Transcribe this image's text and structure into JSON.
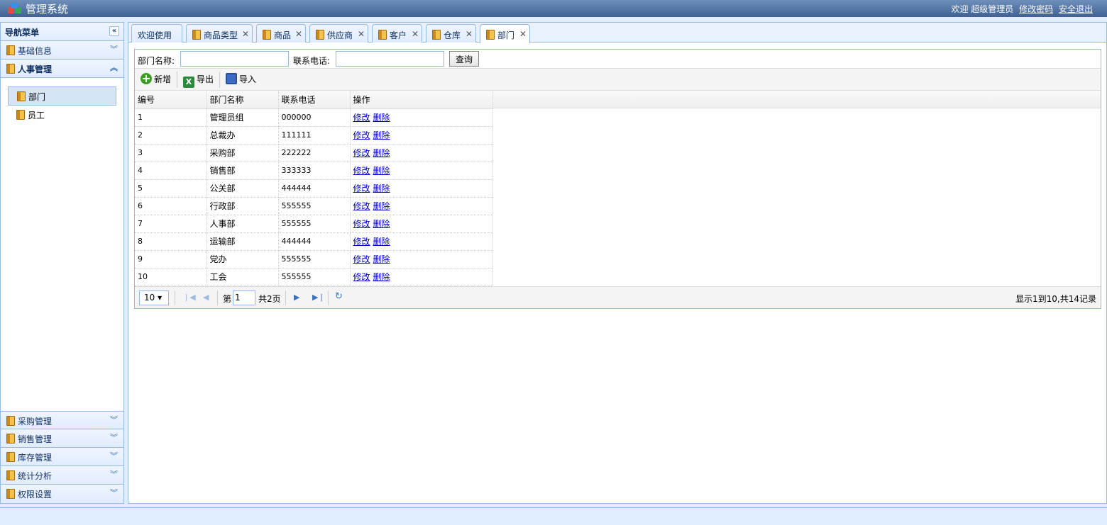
{
  "header": {
    "title": "管理系统",
    "welcome": "欢迎",
    "username": "超级管理员",
    "change_password": "修改密码",
    "logout": "安全退出"
  },
  "sidebar": {
    "title": "导航菜单",
    "collapse_glyph": "«",
    "sections": [
      {
        "label": "基础信息",
        "expanded": false
      },
      {
        "label": "人事管理",
        "expanded": true
      }
    ],
    "items": [
      {
        "label": "部门",
        "selected": true
      },
      {
        "label": "员工",
        "selected": false
      }
    ],
    "bottom_sections": [
      {
        "label": "采购管理"
      },
      {
        "label": "销售管理"
      },
      {
        "label": "库存管理"
      },
      {
        "label": "统计分析"
      },
      {
        "label": "权限设置"
      }
    ]
  },
  "tabs": [
    {
      "label": "欢迎使用",
      "icon": false,
      "closable": false
    },
    {
      "label": "商品类型",
      "icon": true,
      "closable": true
    },
    {
      "label": "商品",
      "icon": true,
      "closable": true
    },
    {
      "label": "供应商",
      "icon": true,
      "closable": true
    },
    {
      "label": "客户",
      "icon": true,
      "closable": true
    },
    {
      "label": "仓库",
      "icon": true,
      "closable": true
    },
    {
      "label": "部门",
      "icon": true,
      "closable": true,
      "active": true
    }
  ],
  "search": {
    "dept_name_label": "部门名称:",
    "phone_label": "联系电话:",
    "dept_name_value": "",
    "phone_value": "",
    "query_button": "查询"
  },
  "toolbar": {
    "add": "新增",
    "export": "导出",
    "import": "导入"
  },
  "table": {
    "columns": [
      "编号",
      "部门名称",
      "联系电话",
      "操作"
    ],
    "edit_label": "修改",
    "delete_label": "删除",
    "rows": [
      {
        "id": "1",
        "name": "管理员组",
        "phone": "000000"
      },
      {
        "id": "2",
        "name": "总裁办",
        "phone": "111111"
      },
      {
        "id": "3",
        "name": "采购部",
        "phone": "222222"
      },
      {
        "id": "4",
        "name": "销售部",
        "phone": "333333"
      },
      {
        "id": "5",
        "name": "公关部",
        "phone": "444444"
      },
      {
        "id": "6",
        "name": "行政部",
        "phone": "555555"
      },
      {
        "id": "7",
        "name": "人事部",
        "phone": "555555"
      },
      {
        "id": "8",
        "name": "运输部",
        "phone": "444444"
      },
      {
        "id": "9",
        "name": "党办",
        "phone": "555555"
      },
      {
        "id": "10",
        "name": "工会",
        "phone": "555555"
      }
    ]
  },
  "pager": {
    "page_size": "10 ▾",
    "page_prefix": "第",
    "current_page": "1",
    "total_pages": "共2页",
    "info": "显示1到10,共14记录"
  },
  "colors": {
    "header_bg": "#4a6fa5",
    "border": "#95b8e7",
    "panel_bg": "#e0ecff",
    "link": "#0000cc"
  }
}
